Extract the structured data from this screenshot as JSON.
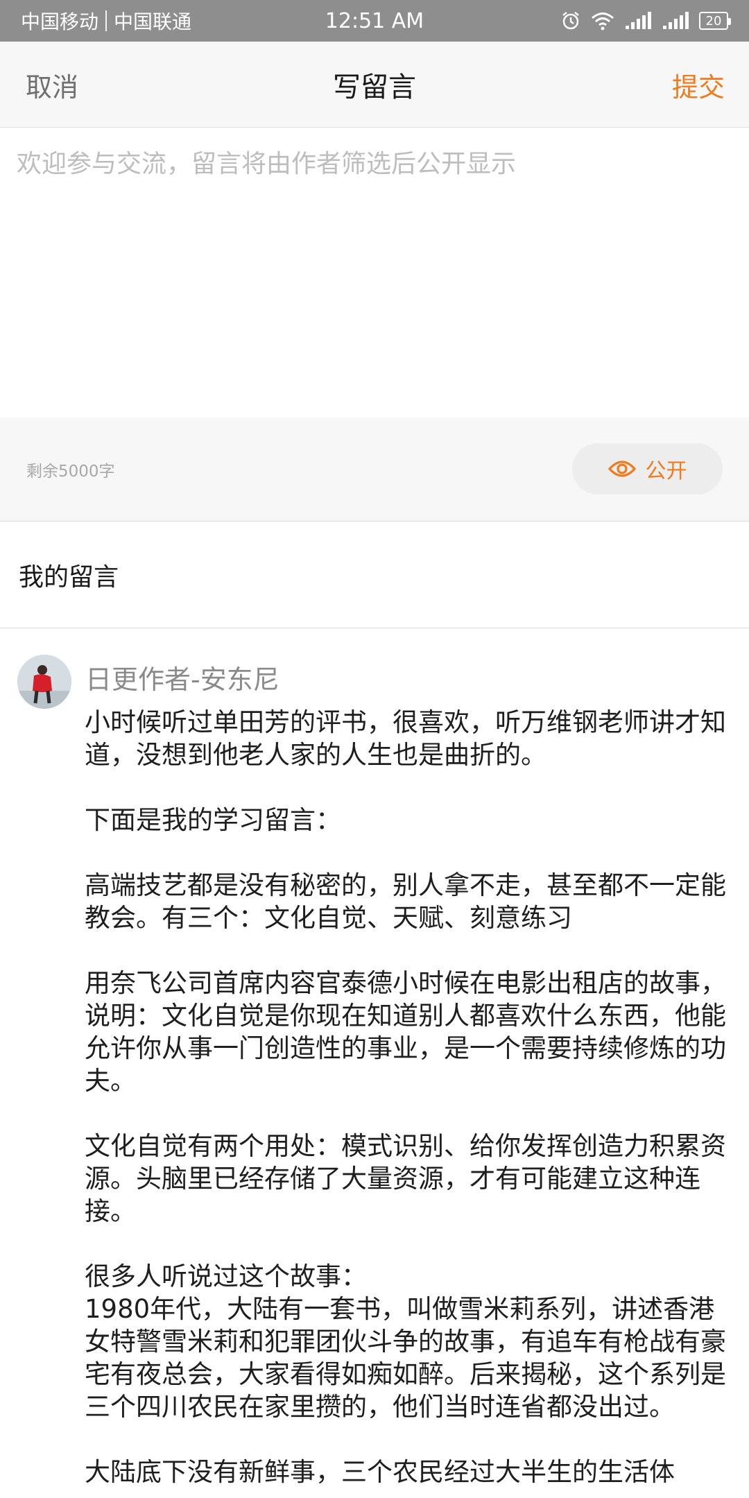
{
  "status_bar": {
    "carrier_1": "中国移动",
    "carrier_2": "中国联通",
    "time": "12:51 AM",
    "battery": "20",
    "icons": [
      "alarm-icon",
      "wifi-icon",
      "signal-icon",
      "signal-icon",
      "battery-icon"
    ]
  },
  "header": {
    "cancel_label": "取消",
    "title": "写留言",
    "submit_label": "提交"
  },
  "compose": {
    "value": "",
    "placeholder": "欢迎参与交流，留言将由作者筛选后公开显示",
    "remaining_text": "剩余5000字",
    "visibility_label": "公开",
    "visibility_icon": "eye-icon"
  },
  "my_comments": {
    "title": "我的留言"
  },
  "comment": {
    "author": "日更作者-安东尼",
    "paragraphs": [
      "小时候听过单田芳的评书，很喜欢，听万维钢老师讲才知道，没想到他老人家的人生也是曲折的。",
      "下面是我的学习留言：",
      "高端技艺都是没有秘密的，别人拿不走，甚至都不一定能教会。有三个：文化自觉、天赋、刻意练习",
      "用奈飞公司首席内容官泰德小时候在电影出租店的故事，说明：文化自觉是你现在知道别人都喜欢什么东西，他能允许你从事一门创造性的事业，是一个需要持续修炼的功夫。",
      "文化自觉有两个用处：模式识别、给你发挥创造力积累资源。头脑里已经存储了大量资源，才有可能建立这种连接。",
      "很多人听说过这个故事：\n1980年代，大陆有一套书，叫做雪米莉系列，讲述香港女特警雪米莉和犯罪团伙斗争的故事，有追车有枪战有豪宅有夜总会，大家看得如痴如醉。后来揭秘，这个系列是三个四川农民在家里攒的，他们当时连省都没出过。",
      "大陆底下没有新鲜事，三个农民经过大半生的生活体"
    ]
  },
  "colors": {
    "accent": "#f07b1d",
    "status_bar_bg": "#8e8e8e",
    "header_bg": "#f7f7f7"
  }
}
